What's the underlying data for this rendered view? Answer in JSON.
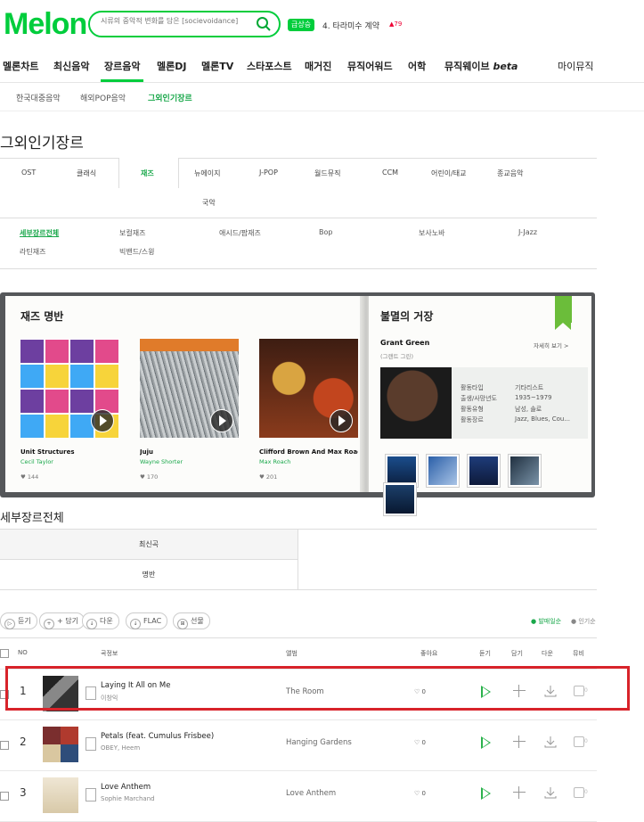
{
  "header": {
    "logo": "Melon",
    "search_placeholder": "시류의 중악적 변화를 담은 [socievoidance]",
    "hot_badge": "급상승",
    "hot_keyword": "4. 타라미수 계약",
    "hot_rank": "▲79"
  },
  "gnb": {
    "items": [
      "멜론차트",
      "최신음악",
      "장르음악",
      "멜론DJ",
      "멜론TV",
      "스타포스트",
      "매거진",
      "뮤직어워드",
      "어학",
      "뮤직웨이브"
    ],
    "beta": "beta",
    "my_music": "마이뮤직"
  },
  "subnav": {
    "items": [
      "한국대중음악",
      "해외POP음악",
      "그외인기장르"
    ]
  },
  "page_title": "그외인기장르",
  "genre_tabs": [
    "OST",
    "클래식",
    "재즈",
    "뉴에이지",
    "J-POP",
    "월드뮤직",
    "CCM",
    "어린이/태교",
    "종교음악",
    "국악"
  ],
  "detail_genres": [
    "세부장르전체",
    "보컬재즈",
    "애시드/팝재즈",
    "Bop",
    "보사노바",
    "J-Jazz",
    "라틴재즈",
    "빅밴드/스윙"
  ],
  "book": {
    "left_title": "재즈 명반",
    "albums": [
      {
        "title": "Unit Structures",
        "artist": "Cecil Taylor",
        "likes": "144"
      },
      {
        "title": "Juju",
        "artist": "Wayne Shorter",
        "likes": "170"
      },
      {
        "title": "Clifford Brown And Max Roach ...",
        "artist": "Max Roach",
        "likes": "201"
      }
    ],
    "right_title": "불멸의 거장",
    "master_name": "Grant Green",
    "master_sub": "(그랜트 그린)",
    "more": "자세히 보기 >",
    "info_labels": [
      "활동타입",
      "출생/사망년도",
      "활동유형",
      "활동장르"
    ],
    "info_values": [
      "기타리스트",
      "1935~1979",
      "남성, 솔로",
      "Jazz, Blues, Cou..."
    ]
  },
  "section_title": "세부장르전체",
  "subtabs": [
    "최신곡",
    "명반"
  ],
  "toolbar": {
    "buttons": [
      "듣기",
      "+ 담기",
      "다운",
      "FLAC",
      "선물"
    ],
    "sort_on": "● 발매일순",
    "sort_off": "● 인기순"
  },
  "table": {
    "headers": [
      "NO",
      "곡정보",
      "앨범",
      "좋아요",
      "듣기",
      "담기",
      "다운",
      "뮤비"
    ],
    "rows": [
      {
        "no": "1",
        "song": "Laying It All on Me",
        "artist": "이창익",
        "album": "The Room",
        "likes": "0",
        "mv": "0"
      },
      {
        "no": "2",
        "song": "Petals (feat. Cumulus Frisbee)",
        "artist": "OBEY, Heem",
        "album": "Hanging Gardens",
        "likes": "0",
        "mv": "0"
      },
      {
        "no": "3",
        "song": "Love Anthem",
        "artist": "Sophie Marchand",
        "album": "Love Anthem",
        "likes": "0",
        "mv": "0"
      }
    ]
  },
  "colors": {
    "brand": "#00cd3c",
    "active_text": "#1aa84b",
    "highlight": "#d8232a"
  }
}
